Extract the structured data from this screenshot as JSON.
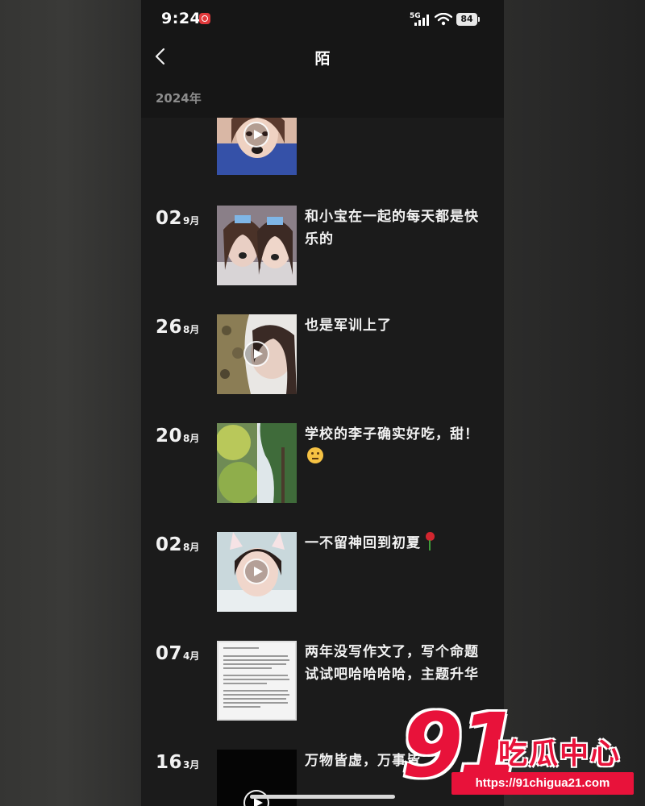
{
  "status_bar": {
    "time": "9:24",
    "network": "5G",
    "battery": "84"
  },
  "header": {
    "title": "陌",
    "back_icon": "chevron-left-icon"
  },
  "year_label": "2024年",
  "entries": [
    {
      "day": "",
      "month": "",
      "caption": "",
      "media": "video",
      "thumb": "selfie-dog-filter"
    },
    {
      "day": "02",
      "month": "9月",
      "caption": "和小宝在一起的每天都是快乐的",
      "media": "photo",
      "thumb": "two-girls-dog-filter"
    },
    {
      "day": "26",
      "month": "8月",
      "caption": "也是军训上了",
      "media": "video",
      "thumb": "camouflage-selfie"
    },
    {
      "day": "20",
      "month": "8月",
      "caption": "学校的李子确实好吃，甜！",
      "caption_emoji": "thinking-face-icon",
      "media": "photo",
      "thumb": "plums-and-tree"
    },
    {
      "day": "02",
      "month": "8月",
      "caption": "一不留神回到初夏",
      "caption_emoji": "rose-icon",
      "media": "video",
      "thumb": "cat-ear-selfie"
    },
    {
      "day": "07",
      "month": "4月",
      "caption": "两年没写作文了，写个命题试试吧哈哈哈哈，主题升华",
      "media": "photo",
      "thumb": "essay-document"
    },
    {
      "day": "16",
      "month": "3月",
      "caption": "万物皆虚，万事皆",
      "media": "video",
      "thumb": "dark-video"
    }
  ],
  "watermark": {
    "number": "91",
    "name": "吃瓜中心",
    "url": "https://91chigua21.com"
  },
  "colors": {
    "background": "#1b1b1b",
    "header": "#161616",
    "text": "#f2f2f2",
    "watermark_red": "#e8123a"
  }
}
